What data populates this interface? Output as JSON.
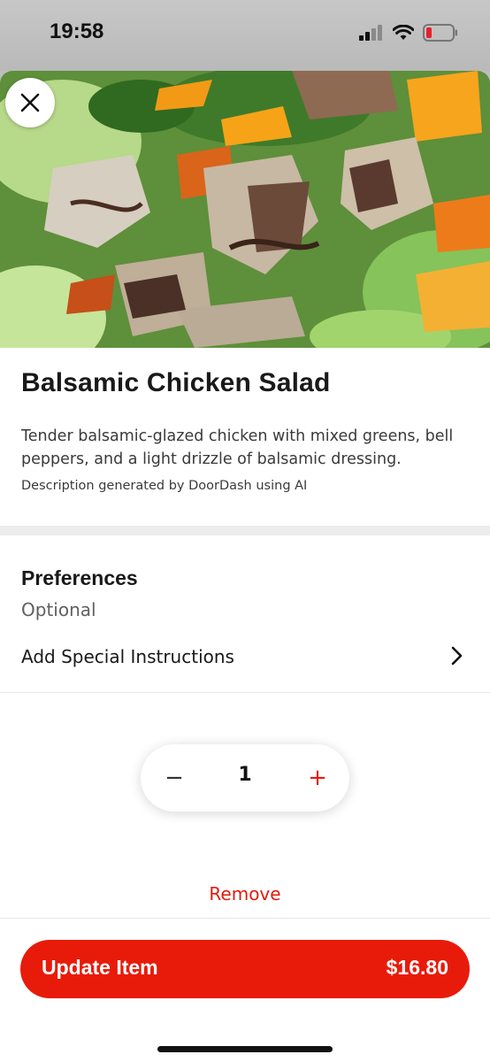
{
  "status_bar": {
    "time": "19:58",
    "icons": [
      "signal-icon",
      "wifi-icon",
      "battery-low-icon"
    ]
  },
  "item": {
    "image_alt": "Balsamic chicken salad photo",
    "title": "Balsamic Chicken Salad",
    "description": "Tender balsamic-glazed chicken with mixed greens, bell peppers, and a light drizzle of balsamic dressing.",
    "ai_note": "Description generated by DoorDash using AI"
  },
  "preferences": {
    "title": "Preferences",
    "subtitle": "Optional",
    "special_instructions_label": "Add Special Instructions"
  },
  "quantity": {
    "minus": "−",
    "value": "1",
    "plus": "+"
  },
  "remove_label": "Remove",
  "footer": {
    "button_label": "Update Item",
    "price": "$16.80"
  },
  "colors": {
    "brand_red": "#e81b0a",
    "accent_red_text": "#e31b0d"
  }
}
